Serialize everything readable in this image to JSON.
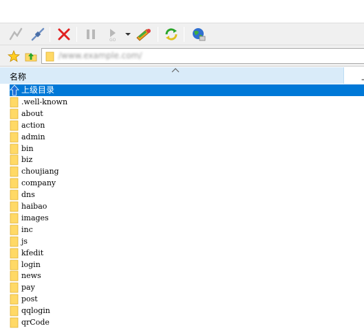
{
  "toolbar": {
    "buttons": [
      {
        "name": "connect-icon"
      },
      {
        "name": "disconnect-icon"
      },
      {
        "name": "stop-icon"
      },
      {
        "name": "pause-icon"
      },
      {
        "name": "play-icon"
      },
      {
        "name": "transfer-icon"
      },
      {
        "name": "refresh-icon"
      },
      {
        "name": "globe-icon"
      }
    ],
    "colors": {
      "stop": "#e02020",
      "disabled": "#b8b8b8",
      "refresh": "#2aa52a",
      "globe": "#2f6fd0"
    }
  },
  "address": {
    "value": "/www.example.com/"
  },
  "columns": {
    "name": "名称",
    "next": "上"
  },
  "files": {
    "parent": "上级目录",
    "items": [
      ".well-known",
      "about",
      "action",
      "admin",
      "bin",
      "biz",
      "choujiang",
      "company",
      "dns",
      "haibao",
      "images",
      "inc",
      "js",
      "kfedit",
      "login",
      "news",
      "pay",
      "post",
      "qqlogin",
      "qrCode"
    ]
  },
  "colors": {
    "selection": "#0078d7",
    "header": "#d9ebf9",
    "folder": "#ffd966",
    "folder_edge": "#e0b030"
  }
}
